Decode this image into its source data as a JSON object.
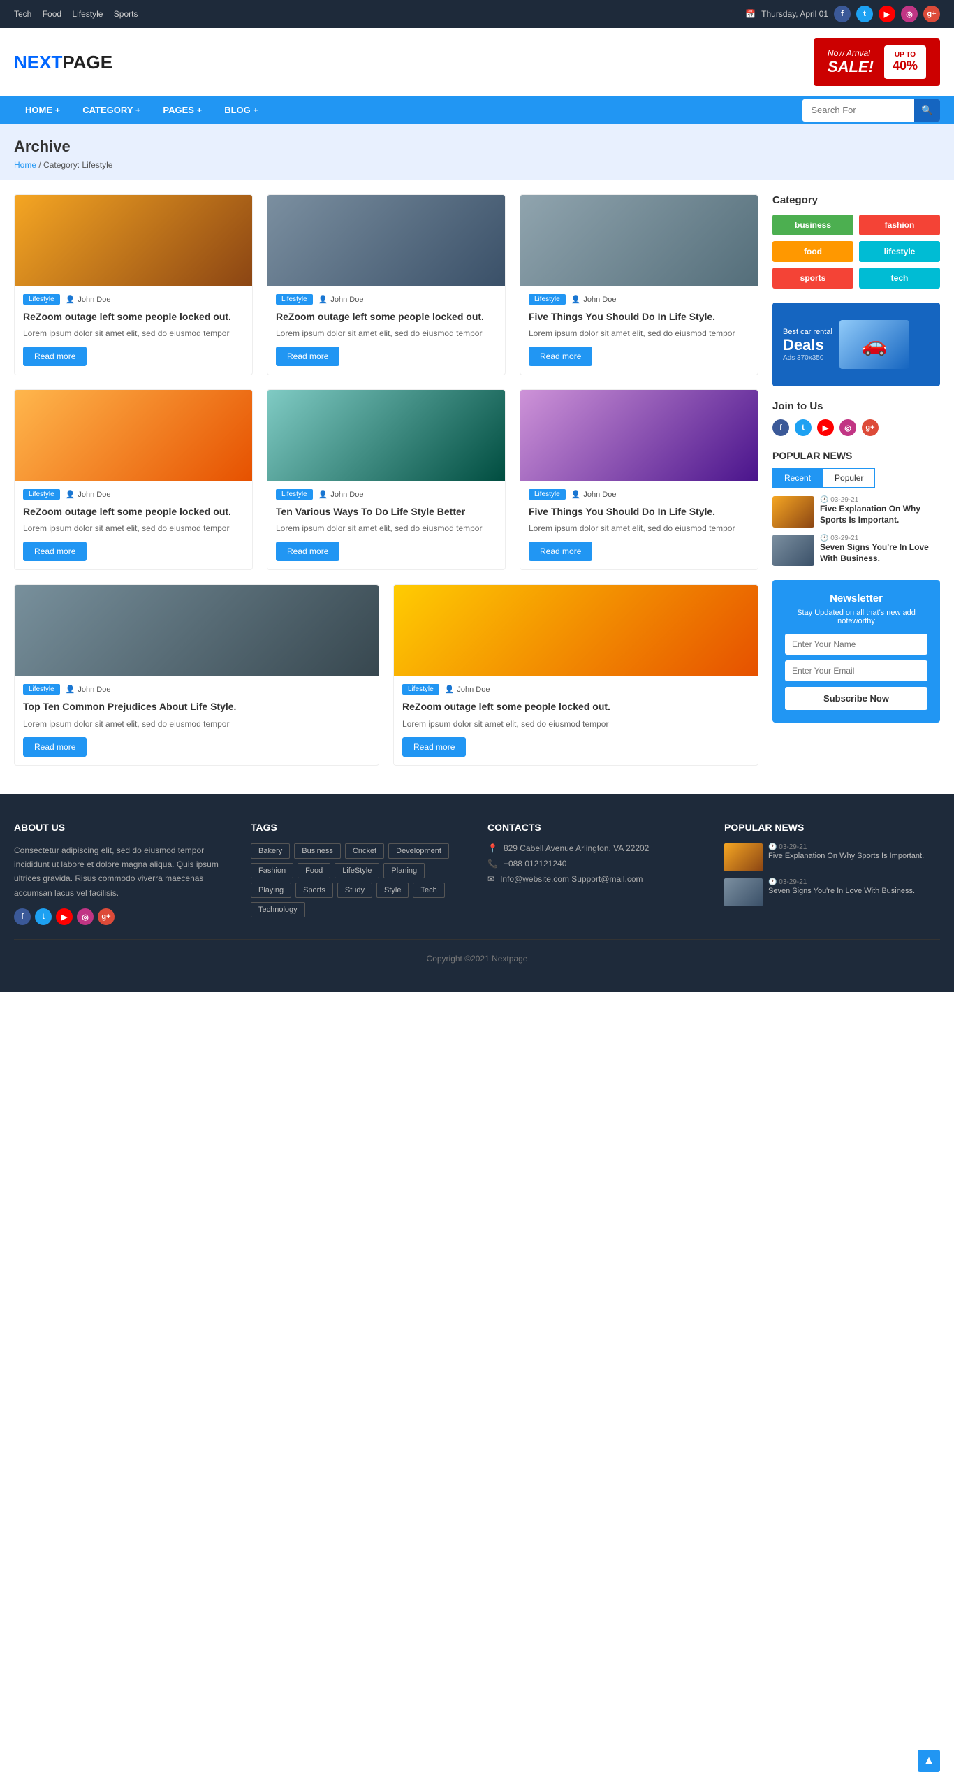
{
  "topbar": {
    "nav": [
      "Tech",
      "Food",
      "Lifestyle",
      "Sports"
    ],
    "date": "Thursday, April 01",
    "calendar_icon": "📅"
  },
  "header": {
    "logo_next": "NEXT",
    "logo_page": "PAGE",
    "banner": {
      "arrival": "Now Arrival",
      "sale": "SALE!",
      "discount": "UP TO",
      "percent": "40%"
    }
  },
  "nav": {
    "items": [
      "HOME +",
      "CATEGORY +",
      "PAGES +",
      "BLOG +"
    ],
    "search_placeholder": "Search For"
  },
  "breadcrumb": {
    "title": "Archive",
    "home": "Home",
    "category": "Category: Lifestyle"
  },
  "articles": [
    {
      "tag": "Lifestyle",
      "author": "John Doe",
      "title": "ReZoom outage left some people locked out.",
      "excerpt": "Lorem ipsum dolor sit amet elit, sed do eiusmod tempor",
      "btn": "Read more",
      "img_class": "img-ph1"
    },
    {
      "tag": "Lifestyle",
      "author": "John Doe",
      "title": "ReZoom outage left some people locked out.",
      "excerpt": "Lorem ipsum dolor sit amet elit, sed do eiusmod tempor",
      "btn": "Read more",
      "img_class": "img-ph2"
    },
    {
      "tag": "Lifestyle",
      "author": "John Doe",
      "title": "Five Things You Should Do In Life Style.",
      "excerpt": "Lorem ipsum dolor sit amet elit, sed do eiusmod tempor",
      "btn": "Read more",
      "img_class": "img-ph3"
    },
    {
      "tag": "Lifestyle",
      "author": "John Doe",
      "title": "ReZoom outage left some people locked out.",
      "excerpt": "Lorem ipsum dolor sit amet elit, sed do eiusmod tempor",
      "btn": "Read more",
      "img_class": "img-ph4"
    },
    {
      "tag": "Lifestyle",
      "author": "John Doe",
      "title": "Ten Various Ways To Do Life Style Better",
      "excerpt": "Lorem ipsum dolor sit amet elit, sed do eiusmod tempor",
      "btn": "Read more",
      "img_class": "img-ph5"
    },
    {
      "tag": "Lifestyle",
      "author": "John Doe",
      "title": "Five Things You Should Do In Life Style.",
      "excerpt": "Lorem ipsum dolor sit amet elit, sed do eiusmod tempor",
      "btn": "Read more",
      "img_class": "img-ph6"
    },
    {
      "tag": "Lifestyle",
      "author": "John Doe",
      "title": "Top Ten Common Prejudices About Life Style.",
      "excerpt": "Lorem ipsum dolor sit amet elit, sed do eiusmod tempor",
      "btn": "Read more",
      "img_class": "img-ph7"
    },
    {
      "tag": "Lifestyle",
      "author": "John Doe",
      "title": "ReZoom outage left some people locked out.",
      "excerpt": "Lorem ipsum dolor sit amet elit, sed do eiusmod tempor",
      "btn": "Read more",
      "img_class": "img-ph8"
    }
  ],
  "sidebar": {
    "category_title": "Category",
    "categories": [
      {
        "label": "business",
        "class": "cat-business"
      },
      {
        "label": "fashion",
        "class": "cat-fashion"
      },
      {
        "label": "food",
        "class": "cat-food"
      },
      {
        "label": "lifestyle",
        "class": "cat-lifestyle"
      },
      {
        "label": "sports",
        "class": "cat-sports"
      },
      {
        "label": "tech",
        "class": "cat-tech"
      }
    ],
    "ad": {
      "best": "Best car rental",
      "deals": "Deals",
      "ads_label": "Ads 370x350"
    },
    "join_title": "Join to Us",
    "popular_title": "POPULAR NEWS",
    "tabs": [
      "Recent",
      "Populer"
    ],
    "news": [
      {
        "date": "03-29-21",
        "title": "Five Explanation On Why Sports Is Important."
      },
      {
        "date": "03-29-21",
        "title": "Seven Signs You're In Love With Business."
      }
    ],
    "newsletter": {
      "title": "Newsletter",
      "desc": "Stay Updated on all that's new add noteworthy",
      "name_placeholder": "Enter Your Name",
      "email_placeholder": "Enter Your Email",
      "btn": "Subscribe Now"
    }
  },
  "footer": {
    "about_title": "ABOUT US",
    "about_text": "Consectetur adipiscing elit, sed do eiusmod tempor incididunt ut labore et dolore magna aliqua. Quis ipsum ultrices gravida. Risus commodo viverra maecenas accumsan lacus vel facilisis.",
    "tags_title": "TAGS",
    "tags": [
      "Bakery",
      "Business",
      "Cricket",
      "Development",
      "Fashion",
      "Food",
      "LifeStyle",
      "Planing",
      "Playing",
      "Sports",
      "Study",
      "Style",
      "Tech",
      "Technology"
    ],
    "contacts_title": "CONTACTS",
    "contacts": [
      {
        "icon": "📍",
        "text": "829 Cabell Avenue Arlington, VA 22202"
      },
      {
        "icon": "📞",
        "text": "+088 012121240"
      },
      {
        "icon": "✉",
        "text": "Info@website.com\nSupport@mail.com"
      }
    ],
    "popular_title": "POPULAR NEWS",
    "popular_news": [
      {
        "date": "03-29-21",
        "title": "Five Explanation On Why Sports Is Important."
      },
      {
        "date": "03-29-21",
        "title": "Seven Signs You're In Love With Business."
      }
    ],
    "copyright": "Copyright ©2021 Nextpage"
  }
}
